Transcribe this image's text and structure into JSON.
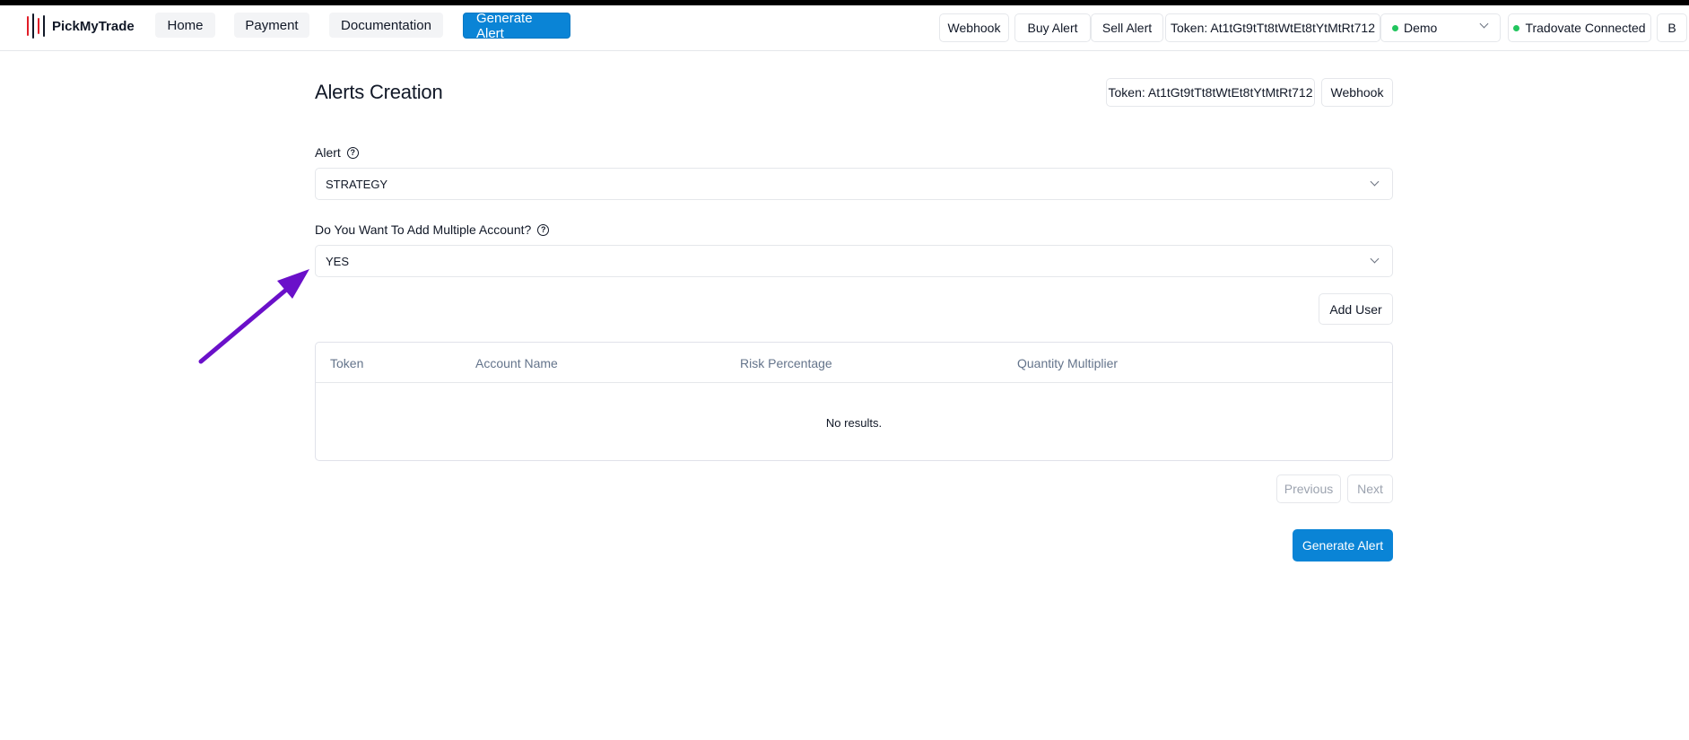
{
  "brand": {
    "name": "PickMyTrade",
    "bar_colors": [
      "#e11d27",
      "#111827",
      "#e11d27",
      "#111827"
    ]
  },
  "nav": {
    "left": [
      "Home",
      "Payment",
      "Documentation"
    ],
    "primary": "Generate Alert",
    "right": {
      "webhook": "Webhook",
      "buy_alert": "Buy Alert",
      "sell_alert": "Sell Alert",
      "token": "Token: At1tGt9tTt8tWtEt8tYtMtRt712",
      "account_select": "Demo",
      "connection_status": "Tradovate Connected",
      "user_initial": "B"
    }
  },
  "page": {
    "title": "Alerts Creation",
    "token_button": "Token: At1tGt9tTt8tWtEt8tYtMtRt712",
    "webhook_button": "Webhook"
  },
  "form": {
    "alert_label": "Alert",
    "alert_value": "STRATEGY",
    "multi_label": "Do You Want To Add Multiple Account?",
    "multi_value": "YES",
    "add_user": "Add User"
  },
  "table": {
    "columns": [
      "Token",
      "Account Name",
      "Risk Percentage",
      "Quantity Multiplier"
    ],
    "rows": [],
    "empty_text": "No results."
  },
  "pagination": {
    "previous": "Previous",
    "next": "Next"
  },
  "submit": {
    "label": "Generate Alert"
  },
  "colors": {
    "accent": "#0a84d6",
    "status_dot": "#22c55e",
    "annotation_arrow": "#6a10c9"
  },
  "icons": {
    "help": "question-circle-icon",
    "dropdown": "chevron-down-icon",
    "status": "status-dot-icon",
    "annotation": "arrow-annotation"
  }
}
